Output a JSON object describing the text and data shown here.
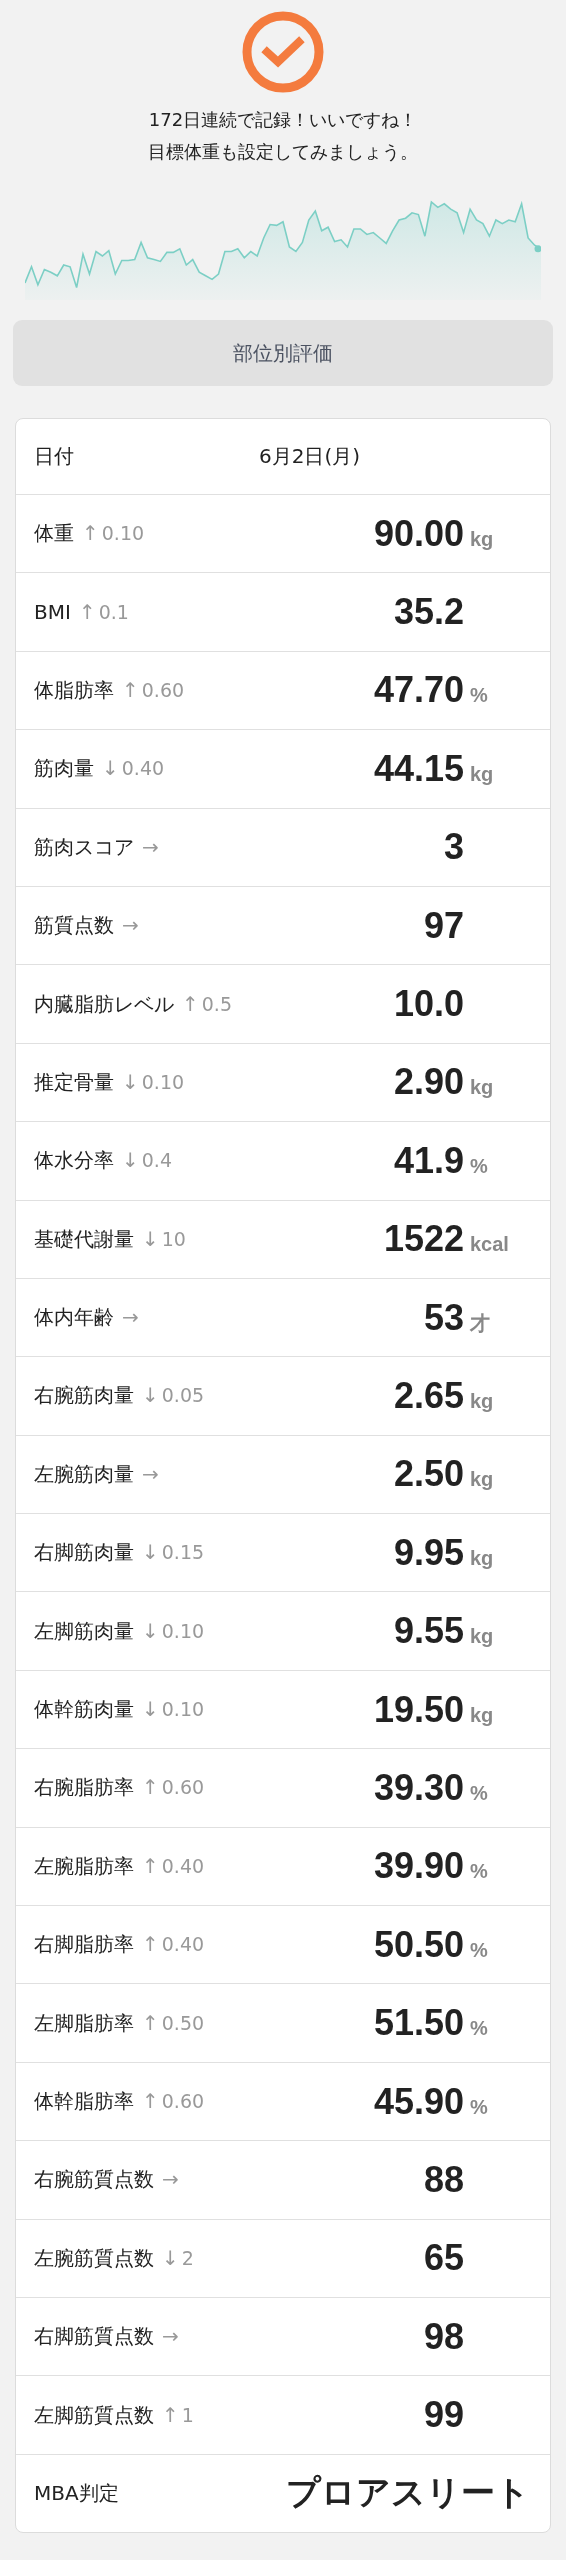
{
  "message": {
    "lines": [
      "172日連続で記録！いいですね！",
      "目標体重も設定してみましょう。"
    ]
  },
  "part_button": {
    "label": "部位別評価"
  },
  "table": {
    "rows": [
      {
        "kind": "date",
        "label": "日付",
        "value": "6月2日(月)"
      },
      {
        "kind": "metric",
        "label": "体重",
        "arrow": "↑",
        "change": "0.10",
        "value": "90.00",
        "unit": "kg"
      },
      {
        "kind": "metric",
        "label": "BMI",
        "arrow": "↑",
        "change": "0.1",
        "value": "35.2"
      },
      {
        "kind": "metric",
        "label": "体脂肪率",
        "arrow": "↑",
        "change": "0.60",
        "value": "47.70",
        "unit": "%"
      },
      {
        "kind": "metric",
        "label": "筋肉量",
        "arrow": "↓",
        "change": "0.40",
        "value": "44.15",
        "unit": "kg"
      },
      {
        "kind": "metric",
        "label": "筋肉スコア",
        "arrow": "→",
        "value": "3"
      },
      {
        "kind": "metric",
        "label": "筋質点数",
        "arrow": "→",
        "value": "97"
      },
      {
        "kind": "metric",
        "label": "内臓脂肪レベル",
        "arrow": "↑",
        "change": "0.5",
        "value": "10.0"
      },
      {
        "kind": "metric",
        "label": "推定骨量",
        "arrow": "↓",
        "change": "0.10",
        "value": "2.90",
        "unit": "kg"
      },
      {
        "kind": "metric",
        "label": "体水分率",
        "arrow": "↓",
        "change": "0.4",
        "value": "41.9",
        "unit": "%"
      },
      {
        "kind": "metric",
        "label": "基礎代謝量",
        "arrow": "↓",
        "change": "10",
        "value": "1522",
        "unit": "kcal"
      },
      {
        "kind": "metric",
        "label": "体内年齢",
        "arrow": "→",
        "value": "53",
        "unit": "才"
      },
      {
        "kind": "metric",
        "label": "右腕筋肉量",
        "arrow": "↓",
        "change": "0.05",
        "value": "2.65",
        "unit": "kg"
      },
      {
        "kind": "metric",
        "label": "左腕筋肉量",
        "arrow": "→",
        "value": "2.50",
        "unit": "kg"
      },
      {
        "kind": "metric",
        "label": "右脚筋肉量",
        "arrow": "↓",
        "change": "0.15",
        "value": "9.95",
        "unit": "kg"
      },
      {
        "kind": "metric",
        "label": "左脚筋肉量",
        "arrow": "↓",
        "change": "0.10",
        "value": "9.55",
        "unit": "kg"
      },
      {
        "kind": "metric",
        "label": "体幹筋肉量",
        "arrow": "↓",
        "change": "0.10",
        "value": "19.50",
        "unit": "kg"
      },
      {
        "kind": "metric",
        "label": "右腕脂肪率",
        "arrow": "↑",
        "change": "0.60",
        "value": "39.30",
        "unit": "%"
      },
      {
        "kind": "metric",
        "label": "左腕脂肪率",
        "arrow": "↑",
        "change": "0.40",
        "value": "39.90",
        "unit": "%"
      },
      {
        "kind": "metric",
        "label": "右脚脂肪率",
        "arrow": "↑",
        "change": "0.40",
        "value": "50.50",
        "unit": "%"
      },
      {
        "kind": "metric",
        "label": "左脚脂肪率",
        "arrow": "↑",
        "change": "0.50",
        "value": "51.50",
        "unit": "%"
      },
      {
        "kind": "metric",
        "label": "体幹脂肪率",
        "arrow": "↑",
        "change": "0.60",
        "value": "45.90",
        "unit": "%"
      },
      {
        "kind": "metric",
        "label": "右腕筋質点数",
        "arrow": "→",
        "value": "88"
      },
      {
        "kind": "metric",
        "label": "左腕筋質点数",
        "arrow": "↓",
        "change": "2",
        "value": "65"
      },
      {
        "kind": "metric",
        "label": "右脚筋質点数",
        "arrow": "→",
        "value": "98"
      },
      {
        "kind": "metric",
        "label": "左脚筋質点数",
        "arrow": "↑",
        "change": "1",
        "value": "99"
      },
      {
        "kind": "verdict",
        "label": "MBA判定",
        "value": "プロアスリート"
      }
    ]
  }
}
